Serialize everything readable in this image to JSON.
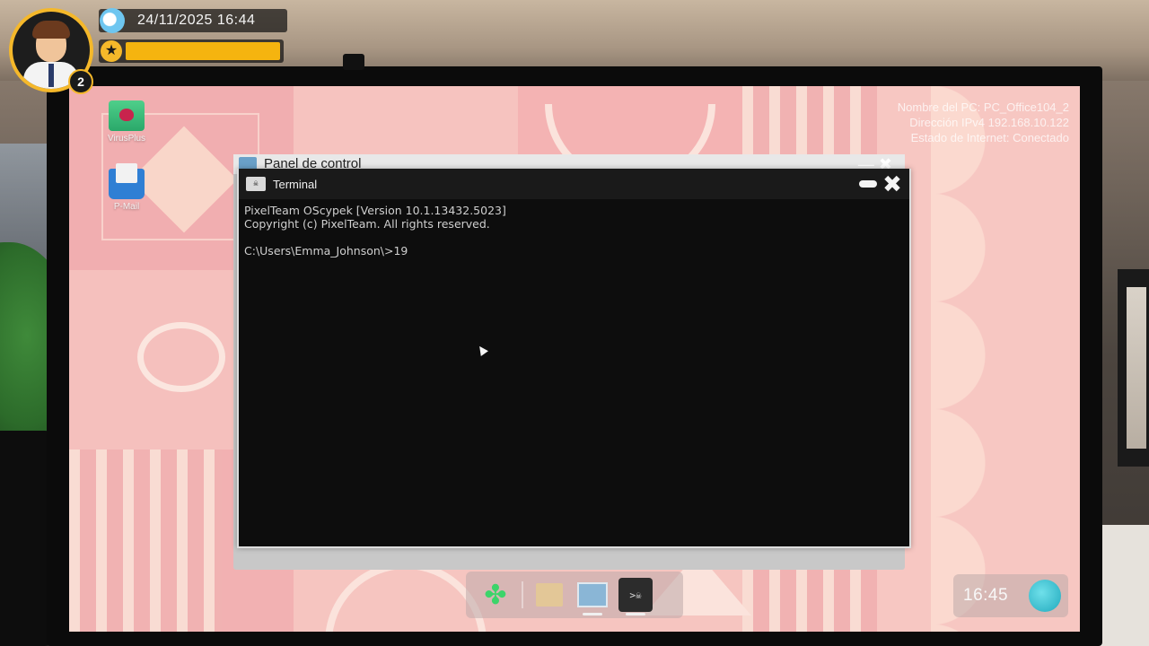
{
  "hud": {
    "level": "2",
    "datetime": "24/11/2025  16:44",
    "xp_progress": 1.0,
    "weather_icon": "cloud-sun-icon",
    "xp_icon": "star-icon"
  },
  "desktop": {
    "icons": [
      {
        "label": "VirusPlus",
        "icon": "virusplus-icon"
      },
      {
        "label": "P-Mail",
        "icon": "mail-icon"
      }
    ],
    "pc_info": {
      "name": "Nombre del PC: PC_Office104_2",
      "ip": "Dirección IPv4 192.168.10.122",
      "internet": "Estado de Internet: Conectado"
    }
  },
  "panel_window": {
    "title": "Panel de control",
    "icon": "control-panel-icon"
  },
  "terminal": {
    "title": "Terminal",
    "icon": "skull-terminal-icon",
    "lines": [
      "PixelTeam OScypek [Version 10.1.13432.5023]",
      "Copyright (c) PixelTeam. All rights reserved.",
      "",
      "C:\\Users\\Emma_Johnson\\>19"
    ],
    "close_glyph": "✖"
  },
  "taskbar": {
    "items": [
      "start-icon",
      "folder-icon",
      "control-panel-icon",
      "terminal-icon"
    ],
    "start_glyph": "✤",
    "term_glyph": ">☠"
  },
  "system_tray": {
    "clock": "16:45",
    "network_icon": "globe-network-icon"
  },
  "colors": {
    "accent": "#f5b82a",
    "xp_fill": "#f5b40f",
    "desktop_pink": "#f3b7b6",
    "terminal_bg": "#0d0d0d",
    "start_green": "#3cd46a"
  }
}
